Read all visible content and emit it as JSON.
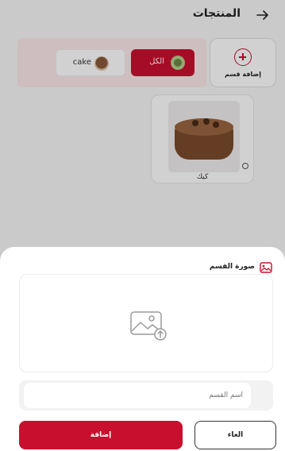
{
  "header": {
    "title": "المنتجات",
    "back_icon": "arrow-right-icon"
  },
  "categories": {
    "add_label": "إضافة قسم",
    "add_icon": "plus-circle-icon",
    "chips": [
      {
        "label": "الكل",
        "active": true
      },
      {
        "label": "cake",
        "active": false
      }
    ]
  },
  "products": [
    {
      "name": "كيك"
    }
  ],
  "sheet": {
    "title": "صورة القسم",
    "title_icon": "image-icon",
    "upload_icon": "image-upload-icon",
    "name_placeholder": "اسم القسم",
    "name_value": "",
    "grid_icon": "grid-icon",
    "add_label": "إضافة",
    "cancel_label": "الغاء"
  },
  "colors": {
    "accent": "#c8102e",
    "chip_background": "#fde8ea"
  }
}
